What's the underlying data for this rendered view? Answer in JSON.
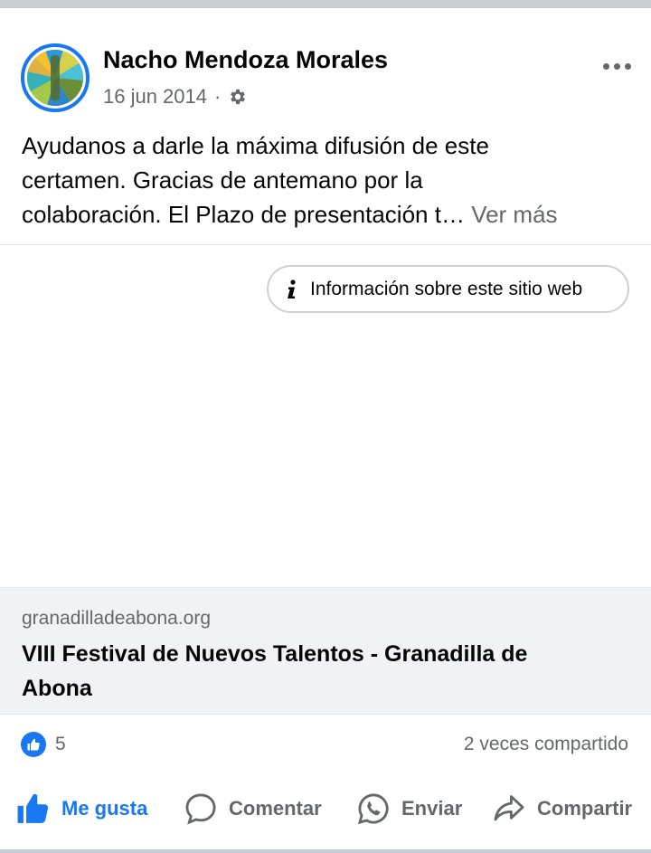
{
  "post": {
    "author": "Nacho Mendoza Morales",
    "date": "16 jun 2014",
    "separator": "·",
    "privacy_icon": "gear-icon",
    "text_lines": [
      "Ayudanos a darle la máxima difusión de este",
      "certamen. Gracias de antemano por la",
      "colaboración. El Plazo de presentación t…"
    ],
    "see_more": "Ver más"
  },
  "media": {
    "info_button": "Información sobre este sitio web"
  },
  "link_card": {
    "domain": "granadilladeabona.org",
    "title": "VIII Festival de Nuevos Talentos - Granadilla de Abona"
  },
  "reactions": {
    "like_count": "5",
    "shares": "2 veces compartido"
  },
  "actions": {
    "like": "Me gusta",
    "comment": "Comentar",
    "send": "Enviar",
    "share": "Compartir"
  },
  "colors": {
    "accent": "#1877f2",
    "secondary_text": "#65676b",
    "card_bg": "#f0f2f5"
  }
}
